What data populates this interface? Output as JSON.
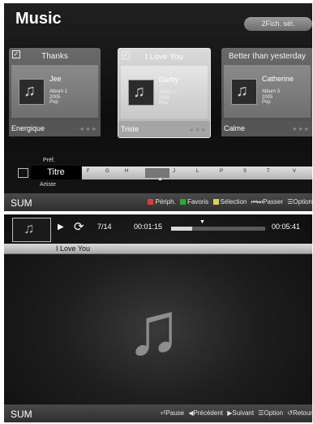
{
  "library": {
    "title": "Music",
    "files_button": "2Fich. sél.",
    "cards": [
      {
        "title": "Thanks",
        "artist": "Jee",
        "album": "Album 1",
        "year": "2005",
        "genre": "Pop",
        "mood": "Energique",
        "checked": true,
        "selected": false,
        "stars": "★★★"
      },
      {
        "title": "I Love You",
        "artist": "Darby",
        "album": "Album 2",
        "year": "2005",
        "genre": "Pop",
        "mood": "Triste",
        "checked": true,
        "selected": true,
        "stars": "★★★"
      },
      {
        "title": "Better than yesterday",
        "artist": "Catherine",
        "album": "Album 3",
        "year": "2005",
        "genre": "Pop",
        "mood": "Calme",
        "checked": false,
        "selected": false,
        "stars": "★★★"
      }
    ],
    "sort": {
      "above": "Préf.",
      "current": "Titre",
      "below": "Artiste"
    },
    "letters": [
      "F",
      "G",
      "H",
      "",
      "J",
      "L",
      "P",
      "S",
      "T",
      "V"
    ],
    "cursor": "▲",
    "footer": {
      "left": "SUM",
      "items": [
        {
          "label": "Périph.",
          "color": "#e03a3a"
        },
        {
          "label": "Favoris",
          "color": "#2fa83a"
        },
        {
          "label": "Sélection",
          "color": "#e0d23a"
        },
        {
          "label": "Passer",
          "glyph": "⏮⏭"
        },
        {
          "label": "Option",
          "glyph": "☰"
        }
      ]
    }
  },
  "player": {
    "track_index": "7/14",
    "elapsed": "00:01:15",
    "total": "00:05:41",
    "progress_fraction": 0.22,
    "now_playing": "I Love You",
    "footer": {
      "left": "SUM",
      "items": [
        {
          "label": "Pause",
          "glyph": "⏎"
        },
        {
          "label": "Précédent",
          "glyph": "◀"
        },
        {
          "label": "Suivant",
          "glyph": "▶"
        },
        {
          "label": "Option",
          "glyph": "☰"
        },
        {
          "label": "Retour",
          "glyph": "↺"
        }
      ]
    }
  },
  "icons": {
    "check": "check-icon",
    "note": "music-note-icon",
    "play": "play-icon",
    "repeat": "repeat-icon",
    "disc": "cd-icon"
  }
}
